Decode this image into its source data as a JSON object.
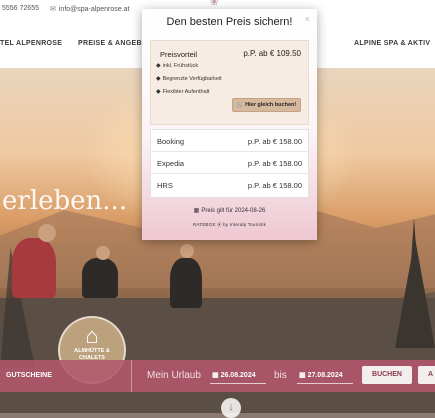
{
  "header": {
    "phone": "5556 72655",
    "email": "info@spa-alpenrose.at",
    "email_icon": "envelope-icon"
  },
  "nav": {
    "items": [
      "TEL ALPENROSE",
      "PREISE & ANGEBO",
      "ALPINE SPA & AKTIV"
    ]
  },
  "hero": {
    "tagline": "erleben..."
  },
  "badge": {
    "icon": "hut-icon",
    "line1": "ALMHÜTTE &",
    "line2": "CHALETS"
  },
  "booking_bar": {
    "gutscheine": "GUTSCHEINE",
    "urlaub_label": "Mein Urlaub",
    "date_from": "26.08.2024",
    "bis": "bis",
    "date_to": "27.08.2024",
    "buchen": "BUCHEN",
    "more": "A"
  },
  "ratebox": {
    "title": "Den besten Preis sichern!",
    "close": "×",
    "best": {
      "label": "Preisvorteil",
      "price": "p.P. ab € 109.50",
      "features": [
        "inkl. Frühstück",
        "Begrenzte Verfügbarkeit",
        "Flexibler Aufenthalt"
      ],
      "button": "Hier gleich buchen!"
    },
    "otas": [
      {
        "name": "Booking",
        "price": "p.P. ab € 158.00"
      },
      {
        "name": "Expedia",
        "price": "p.P. ab € 158.00"
      },
      {
        "name": "HRS",
        "price": "p.P. ab € 158.00"
      }
    ],
    "valid_text": "Preis gilt für 2024-08-26",
    "powered_by": "RATEBOX ⦿ by Interalp Touristik"
  },
  "colors": {
    "accent": "#b2566c",
    "popup_best_bg": "#f7ece3",
    "book_button": "#d6b99d"
  }
}
